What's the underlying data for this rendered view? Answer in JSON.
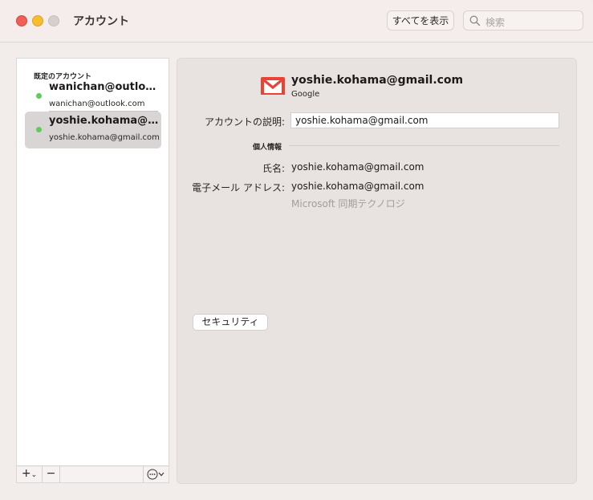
{
  "window": {
    "title": "アカウント",
    "show_all_label": "すべてを表示",
    "search_placeholder": "検索"
  },
  "sidebar": {
    "section_label": "既定のアカウント",
    "accounts": [
      {
        "name": "wanichan@outlook.com",
        "sub": "wanichan@outlook.com",
        "status": "online",
        "selected": false
      },
      {
        "name": "yoshie.kohama@gmail.com",
        "sub": "yoshie.kohama@gmail.com",
        "status": "online",
        "selected": true
      }
    ],
    "add_label": "+",
    "add_chevron": "⌄",
    "remove_label": "−"
  },
  "detail": {
    "title": "yoshie.kohama@gmail.com",
    "provider": "Google",
    "description_label": "アカウントの説明:",
    "description_value": "yoshie.kohama@gmail.com",
    "personal_info_label": "個人情報",
    "full_name_label": "氏名:",
    "full_name_value": "yoshie.kohama@gmail.com",
    "email_label": "電子メール アドレス:",
    "email_value": "yoshie.kohama@gmail.com",
    "sync_note": "Microsoft 同期テクノロジ",
    "security_button": "セキュリティ"
  },
  "colors": {
    "status_online": "#5ecb5b",
    "gmail_red": "#ea4335",
    "selected_row": "#d9d5d4"
  }
}
